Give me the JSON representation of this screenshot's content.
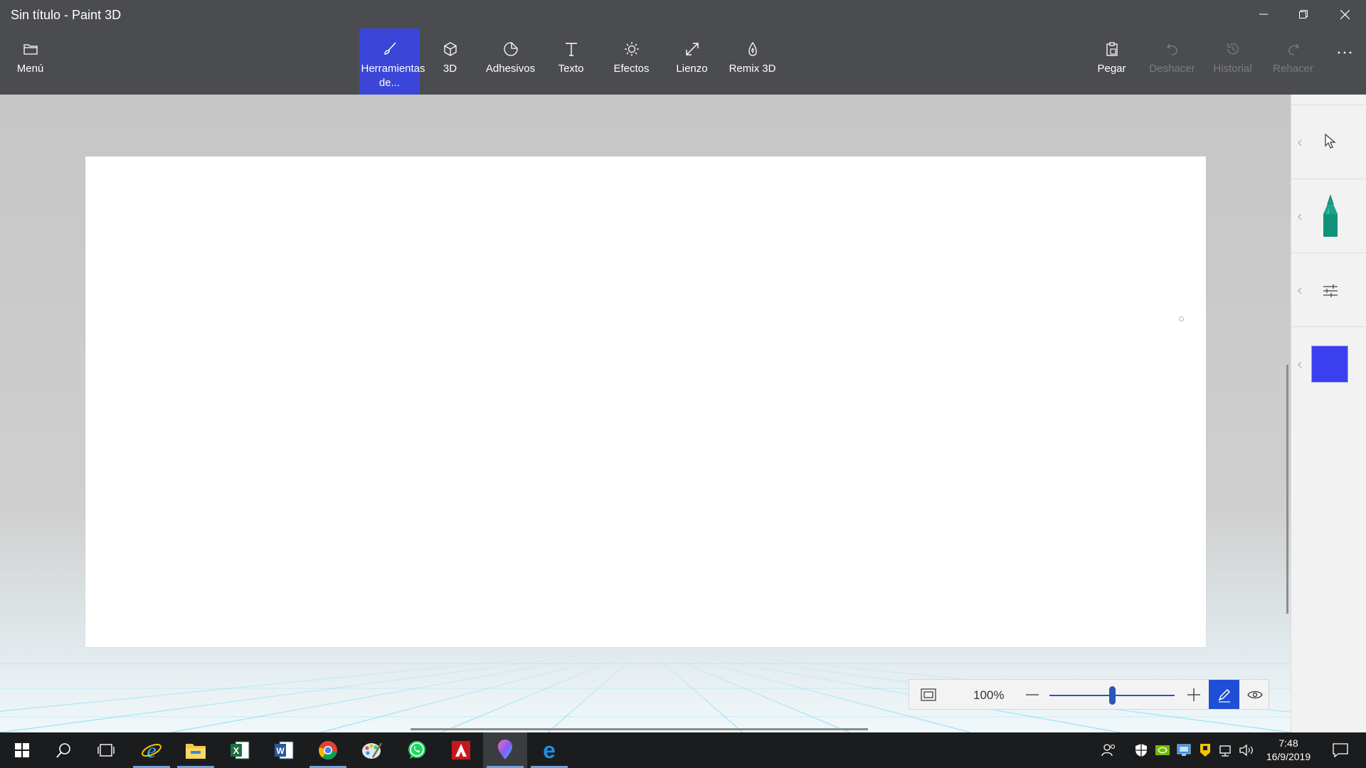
{
  "window": {
    "title": "Sin título - Paint 3D"
  },
  "ribbon": {
    "menu_label": "Menú",
    "tabs": [
      {
        "label": "Herramientas de...",
        "icon": "brush-icon",
        "active": true
      },
      {
        "label": "3D",
        "icon": "cube-icon"
      },
      {
        "label": "Adhesivos",
        "icon": "sticker-icon"
      },
      {
        "label": "Texto",
        "icon": "text-icon"
      },
      {
        "label": "Efectos",
        "icon": "sun-icon"
      },
      {
        "label": "Lienzo",
        "icon": "resize-icon"
      },
      {
        "label": "Remix 3D",
        "icon": "remix-icon"
      }
    ],
    "actions": [
      {
        "label": "Pegar",
        "icon": "clipboard-icon",
        "enabled": true
      },
      {
        "label": "Deshacer",
        "icon": "undo-icon",
        "enabled": false
      },
      {
        "label": "Historial",
        "icon": "history-icon",
        "enabled": false
      },
      {
        "label": "Rehacer",
        "icon": "redo-icon",
        "enabled": false
      }
    ]
  },
  "sidepanel": {
    "tool": "cursor-icon",
    "brush": "marker-icon",
    "brush_color": "#1aa48a",
    "settings": "sliders-icon",
    "color": "#3a3ff0"
  },
  "zoom": {
    "value": "100%",
    "level": 0.5
  },
  "taskbar": {
    "apps": [
      "start-icon",
      "search-icon",
      "task-view-icon",
      "internet-explorer-icon",
      "file-explorer-icon",
      "excel-icon",
      "word-icon",
      "chrome-icon",
      "paint-palette-icon",
      "whatsapp-icon",
      "acrobat-icon",
      "paint-3d-icon",
      "edge-icon"
    ],
    "time": "7:48",
    "date": "16/9/2019"
  },
  "colors": {
    "chrome": "#4b4c50",
    "accent": "#3b46d8",
    "taskbar": "#1b1c1e"
  }
}
